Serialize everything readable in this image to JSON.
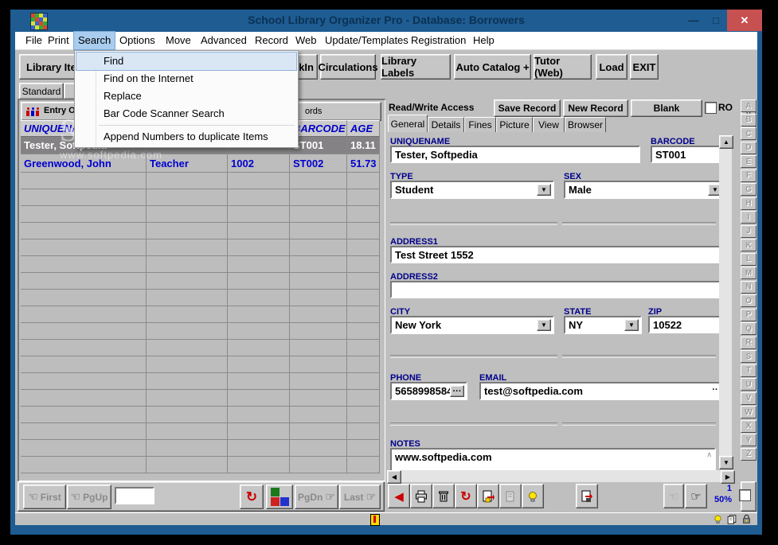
{
  "window": {
    "title": "School Library Organizer Pro - Database: Borrowers"
  },
  "icons": {
    "minimize": "—",
    "maximize": "□",
    "close": "✕",
    "dropdown": "▼",
    "scroll_up": "▲",
    "scroll_down": "▼",
    "scroll_left": "◀",
    "scroll_right": "▶",
    "big_up": "⇧",
    "big_down": "⇩",
    "hand_left": "☜",
    "hand_right": "☞",
    "refresh": "↻",
    "back": "◀",
    "more": "···",
    "more_small": "··",
    "caret_up": "∧"
  },
  "menu_bar": {
    "items": [
      "File",
      "Print",
      "Search",
      "Options",
      "Move",
      "Advanced",
      "Record",
      "Web",
      "Update/Templates",
      "Registration",
      "Help"
    ],
    "active": "Search"
  },
  "search_menu": {
    "items": [
      "Find",
      "Find on the Internet",
      "Replace",
      "Bar Code Scanner Search",
      "Append Numbers to duplicate Items"
    ],
    "highlighted": "Find"
  },
  "toolbar": {
    "buttons": [
      "Library Ite",
      "kIn",
      "Circulations",
      "Library Labels",
      "Auto Catalog +",
      "Tutor (Web)",
      "Load",
      "EXIT"
    ]
  },
  "view_tabs": [
    "Standard",
    "A"
  ],
  "browse": {
    "sort_label": "Entry Order",
    "records_fragment": "ords",
    "columns": [
      "UNIQUENAME",
      "",
      "",
      "BARCODE",
      "AGE"
    ],
    "rows": [
      [
        "Tester, Softpedia",
        "",
        "",
        "ST001",
        "18.11"
      ],
      [
        "Greenwood,  John",
        "Teacher",
        "1002",
        "ST002",
        "51.73"
      ]
    ]
  },
  "record_panel": {
    "access_label": "Read/Write Access",
    "save_button": "Save Record",
    "new_button": "New Record",
    "blank_button": "Blank",
    "ro_label": "RO",
    "tabs": [
      "General",
      "Details",
      "Fines",
      "Picture",
      "View",
      "Browser"
    ],
    "active_tab": "General",
    "fields": {
      "uniquename": {
        "label": "UNIQUENAME",
        "value": "Tester, Softpedia"
      },
      "barcode": {
        "label": "BARCODE",
        "value": "ST001"
      },
      "type": {
        "label": "TYPE",
        "value": "Student"
      },
      "sex": {
        "label": "SEX",
        "value": "Male"
      },
      "address1": {
        "label": "ADDRESS1",
        "value": "Test Street 1552"
      },
      "address2": {
        "label": "ADDRESS2",
        "value": ""
      },
      "city": {
        "label": "CITY",
        "value": "New York"
      },
      "state": {
        "label": "STATE",
        "value": "NY"
      },
      "zip": {
        "label": "ZIP",
        "value": "10522"
      },
      "phone": {
        "label": "PHONE",
        "value": "5658998584"
      },
      "email": {
        "label": "EMAIL",
        "value": "test@softpedia.com"
      },
      "notes": {
        "label": "NOTES",
        "value": "www.softpedia.com"
      }
    }
  },
  "nav": {
    "first": "First",
    "pgup": "PgUp",
    "page_value": "",
    "pgdn": "PgDn",
    "last": "Last"
  },
  "pager": {
    "record_number": "1",
    "zoom": "50%"
  },
  "alphabet": [
    "A",
    "B",
    "C",
    "D",
    "E",
    "F",
    "G",
    "H",
    "I",
    "J",
    "K",
    "L",
    "M",
    "N",
    "O",
    "P",
    "Q",
    "R",
    "S",
    "T",
    "U",
    "V",
    "W",
    "X",
    "Y",
    "Z"
  ],
  "watermark": {
    "line1": "SOFTPEDIA™",
    "line2": "www.softpedia.com"
  }
}
